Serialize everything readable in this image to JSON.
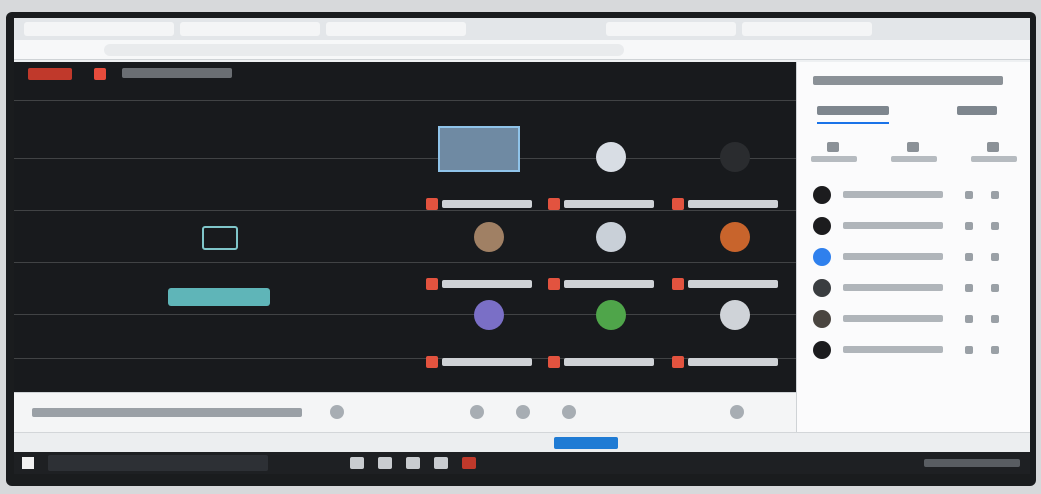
{
  "window": {
    "title": ""
  },
  "meeting": {
    "title": "",
    "participants": [
      {
        "name": "",
        "color": "#8fa6c0",
        "kind": "video"
      },
      {
        "name": "",
        "color": "#d8dde4",
        "kind": "avatar"
      },
      {
        "name": "",
        "color": "#2a2c2f",
        "kind": "avatar"
      },
      {
        "name": "",
        "color": "#a08064",
        "kind": "avatar"
      },
      {
        "name": "",
        "color": "#c9d0d8",
        "kind": "avatar"
      },
      {
        "name": "",
        "color": "#c8642c",
        "kind": "avatar"
      },
      {
        "name": "",
        "color": "#7a6fc6",
        "kind": "avatar"
      },
      {
        "name": "",
        "color": "#4fa54a",
        "kind": "avatar"
      },
      {
        "name": "",
        "color": "#cfd3d8",
        "kind": "avatar"
      }
    ]
  },
  "controls": {
    "caption": ""
  },
  "panel": {
    "title": "",
    "tabs": [
      "",
      ""
    ],
    "actions": [
      "",
      "",
      ""
    ],
    "people": [
      {
        "name": "",
        "color": "#1c1c1e"
      },
      {
        "name": "",
        "color": "#1c1c1e"
      },
      {
        "name": "",
        "color": "#2f80ed"
      },
      {
        "name": "",
        "color": "#3a3d40"
      },
      {
        "name": "",
        "color": "#4a4540"
      },
      {
        "name": "",
        "color": "#1c1c1e"
      }
    ]
  },
  "status": {
    "pill": ""
  },
  "colors": {
    "accent": "#1a73e8",
    "mic_muted": "#e2533f",
    "share": "#5fb5b8"
  }
}
